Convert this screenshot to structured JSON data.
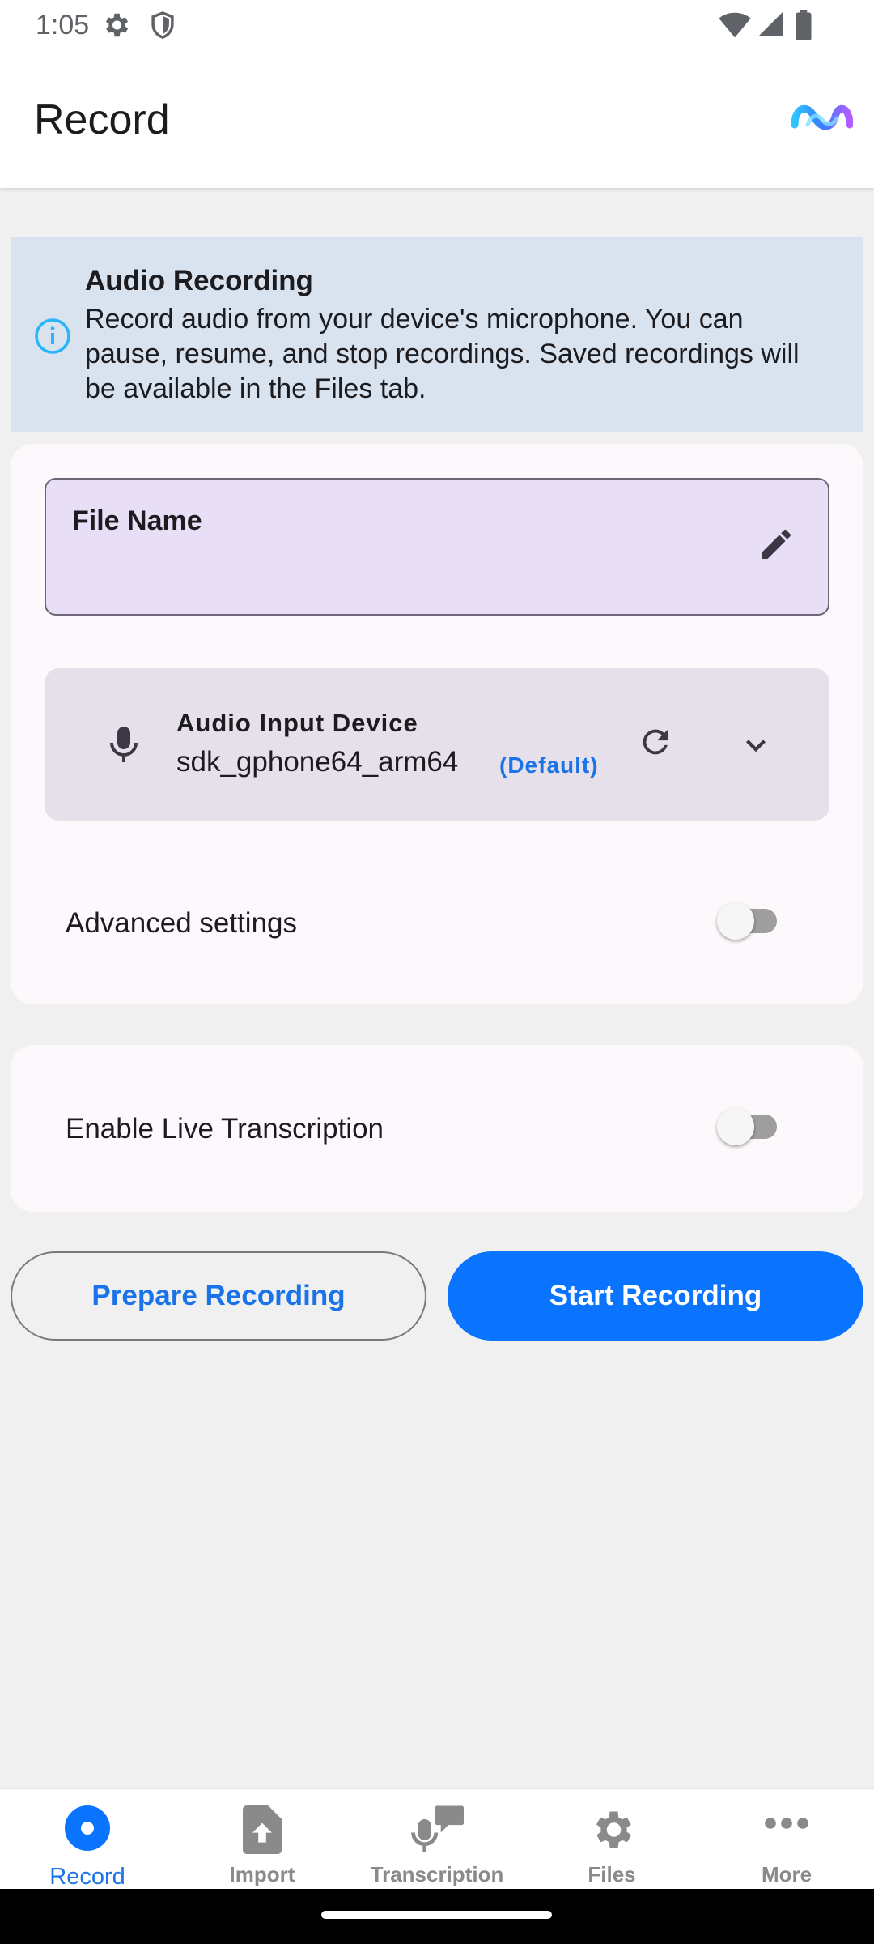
{
  "status_bar": {
    "time": "1:05",
    "left_icons": [
      "gear-icon",
      "shield-icon"
    ],
    "right_icons": [
      "wifi-icon",
      "signal-icon",
      "battery-icon"
    ]
  },
  "app_bar": {
    "title": "Record",
    "logo": "app-logo"
  },
  "info_banner": {
    "title": "Audio Recording",
    "text": "Record audio from your device's microphone. You can pause, resume, and stop recordings. Saved recordings will be available in the Files tab.",
    "icon": "info-icon"
  },
  "file_name": {
    "label": "File Name",
    "value": ""
  },
  "audio_input": {
    "label": "Audio Input Device",
    "value": "sdk_gphone64_arm64",
    "badge": "(Default)"
  },
  "advanced_settings": {
    "label": "Advanced settings",
    "enabled": false
  },
  "live_transcription": {
    "label": "Enable Live Transcription",
    "enabled": false
  },
  "buttons": {
    "prepare": "Prepare Recording",
    "start": "Start Recording"
  },
  "bottom_nav": {
    "items": [
      {
        "label": "Record",
        "icon": "record-icon",
        "active": true
      },
      {
        "label": "Import",
        "icon": "import-icon",
        "active": false
      },
      {
        "label": "Transcription",
        "icon": "transcription-icon",
        "active": false
      },
      {
        "label": "Files",
        "icon": "files-icon",
        "active": false
      },
      {
        "label": "More",
        "icon": "more-icon",
        "active": false
      }
    ]
  },
  "colors": {
    "accent": "#0a74ff",
    "link": "#1a73e8",
    "banner": "#d9e3f0",
    "field": "#e8dff6"
  }
}
